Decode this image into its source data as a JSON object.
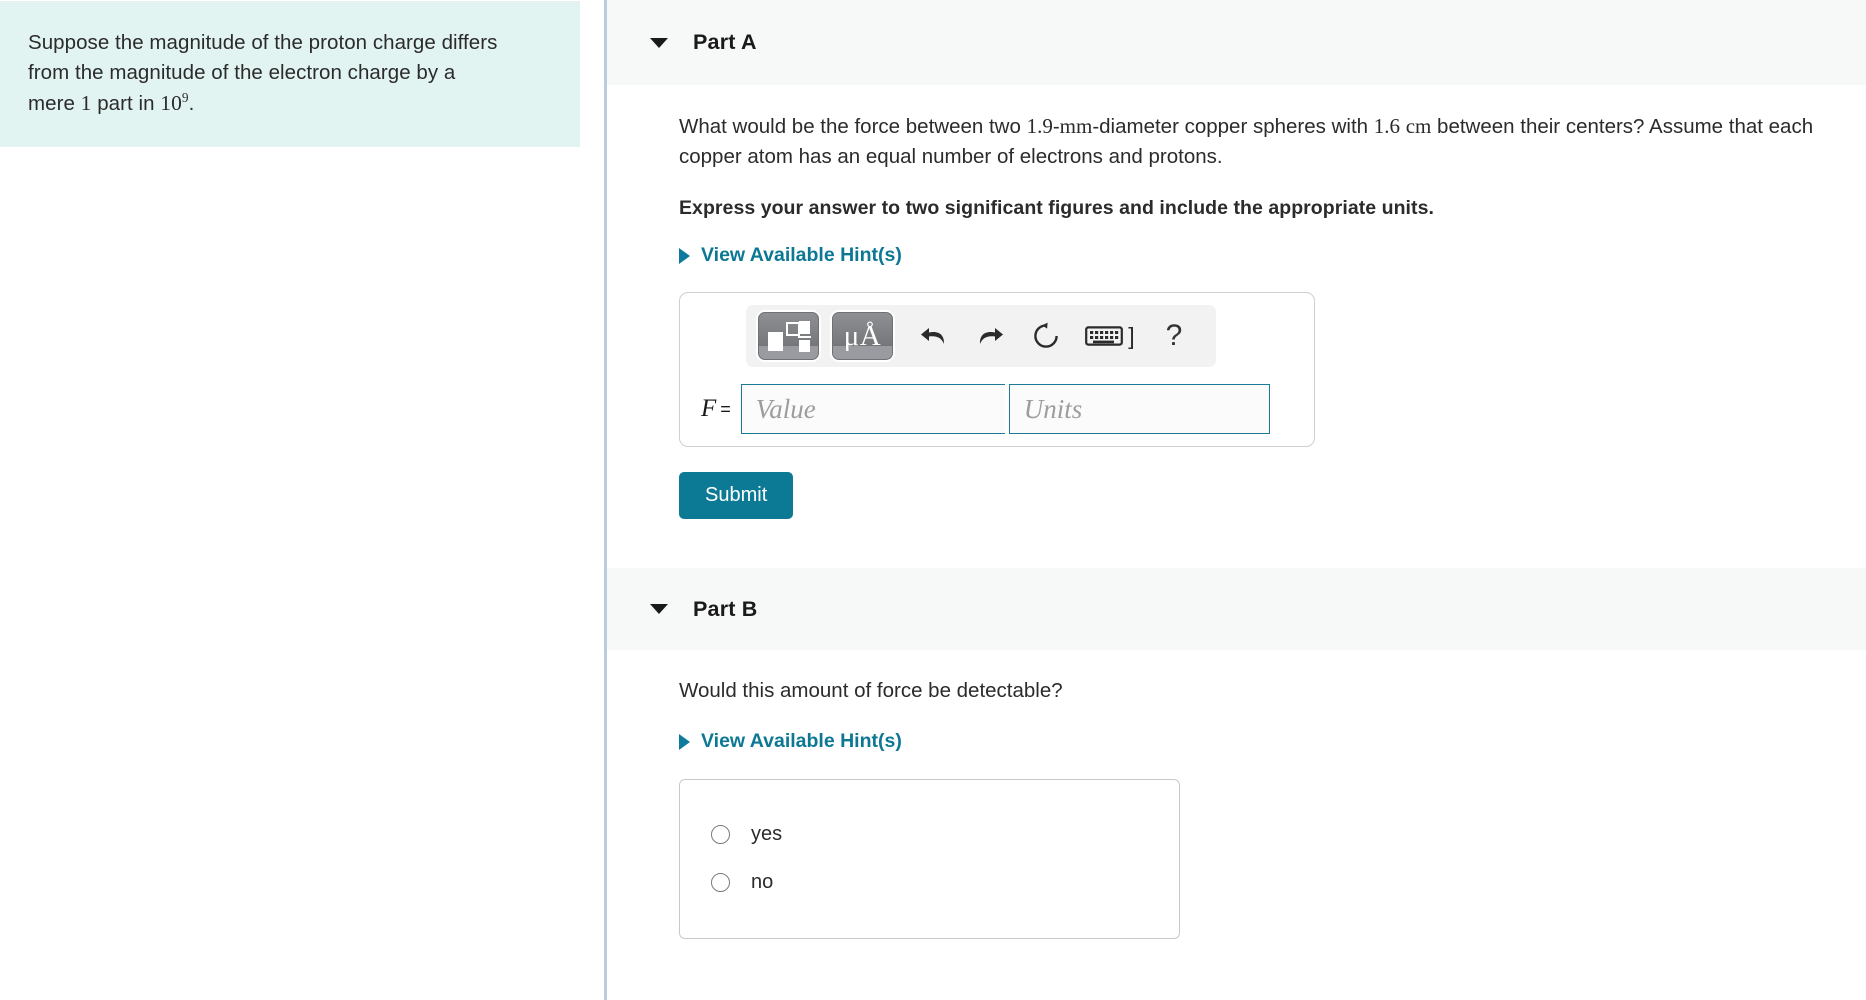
{
  "colors": {
    "problem_panel_bg": "#e2f4f2",
    "accent_teal": "#0d7a95",
    "hint_link": "#0d7894",
    "part_header_bg": "#f7f8f8",
    "divider": "#b9cddc",
    "input_border": "#1b7b96"
  },
  "problem": {
    "line1": "Suppose the magnitude of the proton charge differs",
    "line2": "from the magnitude of the electron charge by a",
    "line3_pre": "mere ",
    "line3_num": "1",
    "line3_mid": " part in ",
    "line3_base": "10",
    "line3_exp": "9",
    "line3_end": "."
  },
  "part_a": {
    "title": "Part A",
    "caret_icon": "caret-down-icon",
    "question_segments": {
      "s1": "What would be the force between two ",
      "n1": "1.9",
      "s2": "-",
      "u1": "mm",
      "s3": "-diameter copper spheres with ",
      "n2": "1.6",
      "u2": "cm",
      "s4": " between their centers? Assume that each copper atom has an equal number of electrons and protons."
    },
    "instruction": "Express your answer to two significant figures and include the appropriate units.",
    "hint_label": "View Available Hint(s)",
    "toolbar": {
      "template_button_icon": "math-template-icon",
      "units_button_label": "μÅ",
      "undo_icon": "undo-arrow-icon",
      "redo_icon": "redo-arrow-icon",
      "reset_icon": "reset-circular-arrow-icon",
      "keyboard_icon": "keyboard-icon",
      "keyboard_bracket": "]",
      "help_label": "?"
    },
    "answer": {
      "variable": "F",
      "equals": "=",
      "value_placeholder": "Value",
      "value": "",
      "units_placeholder": "Units",
      "units": ""
    },
    "submit_label": "Submit"
  },
  "part_b": {
    "title": "Part B",
    "caret_icon": "caret-down-icon",
    "question": "Would this amount of force be detectable?",
    "hint_label": "View Available Hint(s)",
    "options": [
      {
        "label": "yes",
        "selected": false
      },
      {
        "label": "no",
        "selected": false
      }
    ]
  }
}
